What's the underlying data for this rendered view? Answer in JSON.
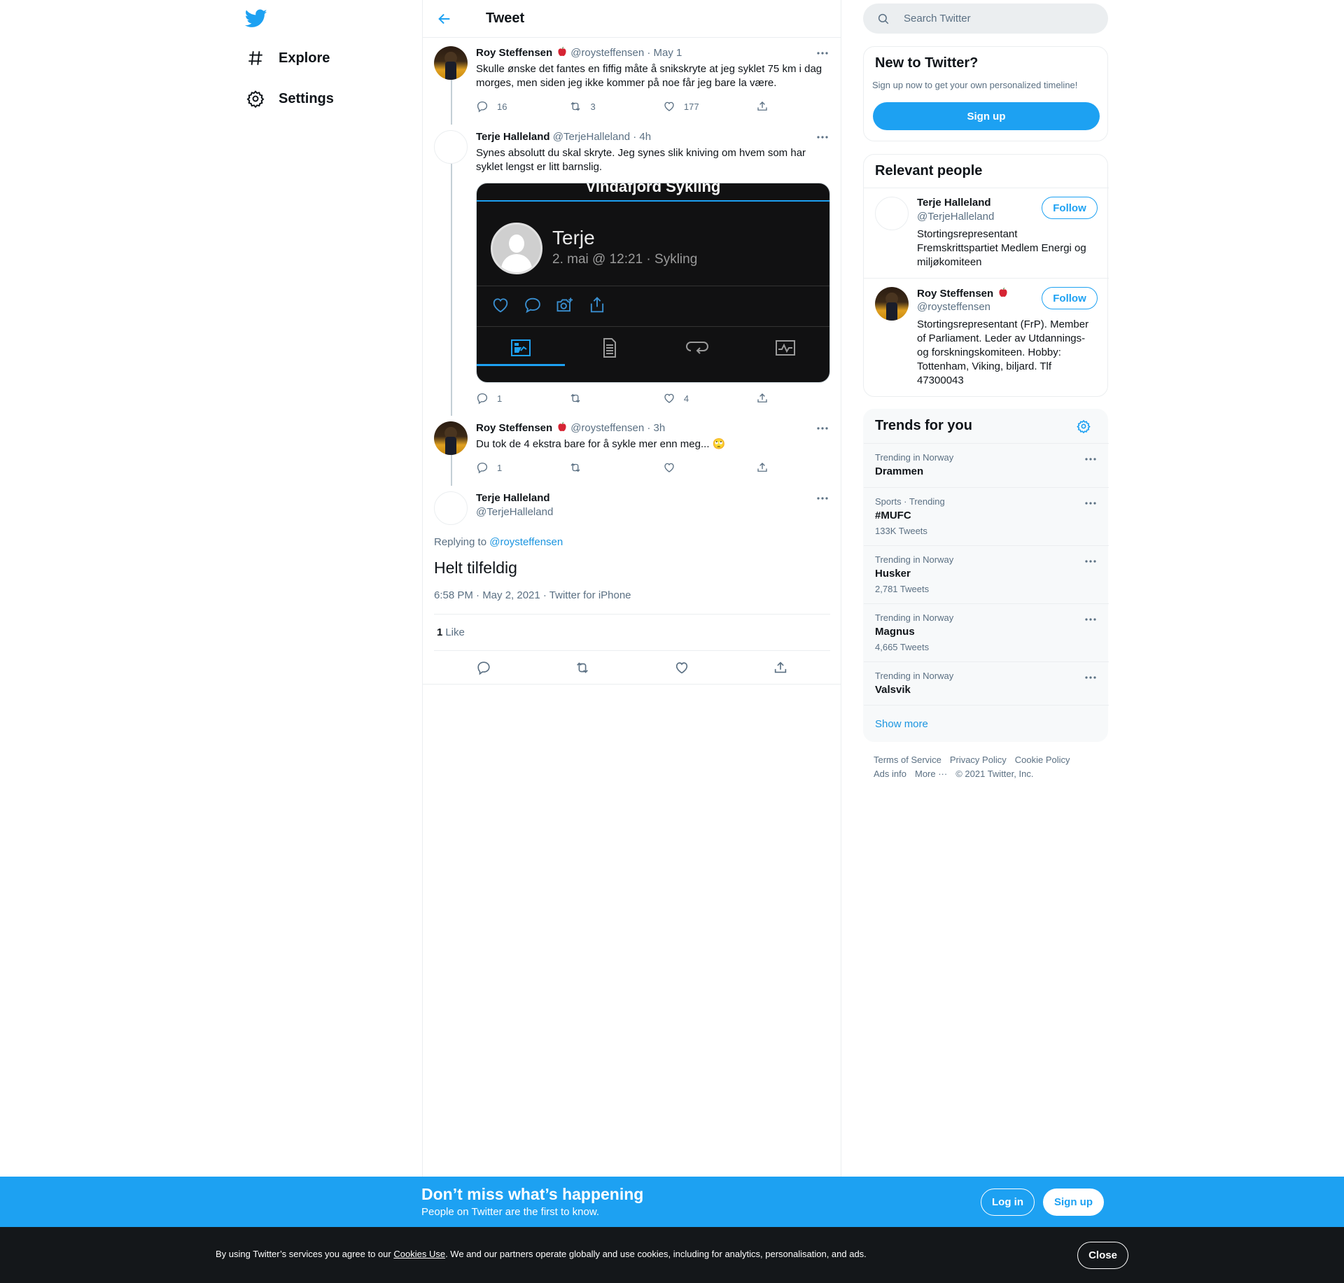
{
  "nav": {
    "explore": "Explore",
    "settings": "Settings"
  },
  "header": {
    "title": "Tweet"
  },
  "thread": [
    {
      "name": "Roy Steffensen",
      "handle": "@roysteffensen",
      "time": "· May 1",
      "text": "Skulle ønske det fantes en fiffig måte å snikskryte at jeg syklet 75 km i dag morges, men siden jeg ikke kommer på noe får jeg bare la være.",
      "replies": "16",
      "retweets": "3",
      "likes": "177"
    },
    {
      "name": "Terje Halleland",
      "handle": "@TerjeHalleland",
      "time": "· 4h",
      "text": "Synes absolutt du skal skryte. Jeg synes slik kniving om hvem som har syklet lengst er litt barnslig.",
      "media": {
        "title": "Vindafjord Sykling",
        "name": "Terje",
        "subtitle": "2. mai @ 12:21 · Sykling"
      },
      "replies": "1",
      "retweets": "",
      "likes": "4"
    },
    {
      "name": "Roy Steffensen",
      "handle": "@roysteffensen",
      "time": "· 3h",
      "text": "Du tok de 4 ekstra bare for å sykle mer enn meg... 🙄",
      "replies": "1",
      "retweets": "",
      "likes": ""
    }
  ],
  "focus": {
    "name": "Terje Halleland",
    "handle": "@TerjeHalleland",
    "replying_prefix": "Replying to",
    "replying_to": "@roysteffensen",
    "text": "Helt tilfeldig",
    "meta": "6:58 PM · May 2, 2021 · Twitter for iPhone",
    "like_count": "1",
    "like_label": "Like"
  },
  "search": {
    "placeholder": "Search Twitter"
  },
  "new_to_twitter": {
    "title": "New to Twitter?",
    "subtitle": "Sign up now to get your own personalized timeline!",
    "button": "Sign up"
  },
  "relevant": {
    "title": "Relevant people",
    "people": [
      {
        "name": "Terje Halleland",
        "handle": "@TerjeHalleland",
        "bio": "Stortingsrepresentant Fremskrittspartiet Medlem Energi og miljøkomiteen",
        "button": "Follow"
      },
      {
        "name": "Roy Steffensen",
        "handle": "@roysteffensen",
        "bio": "Stortingsrepresentant (FrP). Member of Parliament. Leder av Utdannings- og forskningskomiteen. Hobby: Tottenham, Viking, biljard. Tlf 47300043",
        "button": "Follow"
      }
    ]
  },
  "trends": {
    "title": "Trends for you",
    "items": [
      {
        "context": "Trending in Norway",
        "name": "Drammen",
        "count": ""
      },
      {
        "context": "Sports · Trending",
        "name": "#MUFC",
        "count": "133K Tweets"
      },
      {
        "context": "Trending in Norway",
        "name": "Husker",
        "count": "2,781 Tweets"
      },
      {
        "context": "Trending in Norway",
        "name": "Magnus",
        "count": "4,665 Tweets"
      },
      {
        "context": "Trending in Norway",
        "name": "Valsvik",
        "count": ""
      }
    ],
    "show_more": "Show more"
  },
  "footer": {
    "terms": "Terms of Service",
    "privacy": "Privacy Policy",
    "cookie": "Cookie Policy",
    "ads": "Ads info",
    "more": "More ···",
    "copyright": "© 2021 Twitter, Inc."
  },
  "banner": {
    "title": "Don’t miss what’s happening",
    "subtitle": "People on Twitter are the first to know.",
    "login": "Log in",
    "signup": "Sign up"
  },
  "cookie_bar": {
    "prefix": "By using Twitter’s services you agree to our",
    "link": "Cookies Use",
    "suffix": ". We and our partners operate globally and use cookies, including for analytics, personalisation, and ads.",
    "close": "Close"
  },
  "colors": {
    "accent": "#1da1f2",
    "text": "#0f1419",
    "muted": "#5b7083",
    "border": "#ebeef0"
  }
}
